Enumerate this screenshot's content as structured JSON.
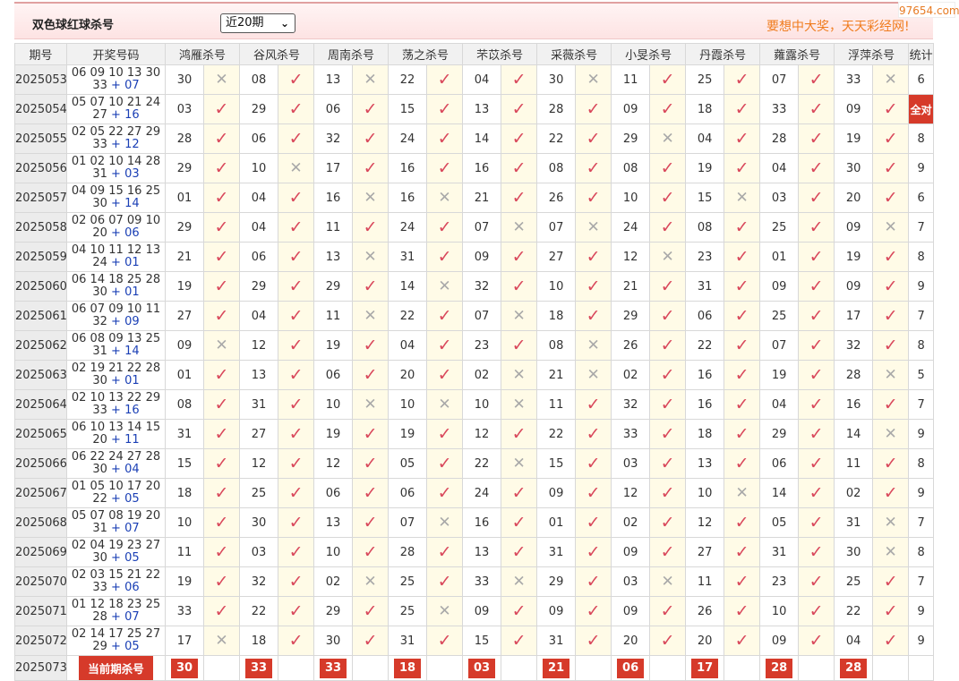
{
  "header": {
    "title": "双色球红球杀号",
    "period_select": "近20期",
    "slogan": "要想中大奖，天天彩经网!",
    "watermark": "97654.com"
  },
  "columns": {
    "issue": "期号",
    "draw": "开奖号码",
    "experts": [
      "鸿雁杀号",
      "谷风杀号",
      "周南杀号",
      "荡之杀号",
      "芣苡杀号",
      "采薇杀号",
      "小旻杀号",
      "丹霞杀号",
      "蕹露杀号",
      "浮萍杀号"
    ],
    "stat": "统计"
  },
  "rows": [
    {
      "issue": "2025053",
      "red": "06 09 10 13 30",
      "red2": "33",
      "blue": "07",
      "kills": [
        "30",
        "08",
        "13",
        "22",
        "04",
        "30",
        "11",
        "25",
        "07",
        "33"
      ],
      "hits": [
        0,
        1,
        0,
        1,
        1,
        0,
        1,
        1,
        1,
        0
      ],
      "stat": "6"
    },
    {
      "issue": "2025054",
      "red": "05 07 10 21 24",
      "red2": "27",
      "blue": "16",
      "kills": [
        "03",
        "29",
        "06",
        "15",
        "13",
        "28",
        "09",
        "18",
        "33",
        "09"
      ],
      "hits": [
        1,
        1,
        1,
        1,
        1,
        1,
        1,
        1,
        1,
        1
      ],
      "stat": "全对"
    },
    {
      "issue": "2025055",
      "red": "02 05 22 27 29",
      "red2": "33",
      "blue": "12",
      "kills": [
        "28",
        "06",
        "32",
        "24",
        "14",
        "22",
        "29",
        "04",
        "28",
        "19"
      ],
      "hits": [
        1,
        1,
        1,
        1,
        1,
        1,
        0,
        1,
        1,
        1
      ],
      "stat": "8"
    },
    {
      "issue": "2025056",
      "red": "01 02 10 14 28",
      "red2": "31",
      "blue": "03",
      "kills": [
        "29",
        "10",
        "17",
        "16",
        "16",
        "08",
        "08",
        "19",
        "04",
        "30"
      ],
      "hits": [
        1,
        0,
        1,
        1,
        1,
        1,
        1,
        1,
        1,
        1
      ],
      "stat": "9"
    },
    {
      "issue": "2025057",
      "red": "04 09 15 16 25",
      "red2": "30",
      "blue": "14",
      "kills": [
        "01",
        "04",
        "16",
        "16",
        "21",
        "26",
        "10",
        "15",
        "03",
        "20"
      ],
      "hits": [
        1,
        1,
        0,
        0,
        1,
        1,
        1,
        0,
        1,
        1
      ],
      "stat": "6"
    },
    {
      "issue": "2025058",
      "red": "02 06 07 09 10",
      "red2": "20",
      "blue": "06",
      "kills": [
        "29",
        "04",
        "11",
        "24",
        "07",
        "07",
        "24",
        "08",
        "25",
        "09"
      ],
      "hits": [
        1,
        1,
        1,
        1,
        0,
        0,
        1,
        1,
        1,
        0
      ],
      "stat": "7"
    },
    {
      "issue": "2025059",
      "red": "04 10 11 12 13",
      "red2": "24",
      "blue": "01",
      "kills": [
        "21",
        "06",
        "13",
        "31",
        "09",
        "27",
        "12",
        "23",
        "01",
        "19"
      ],
      "hits": [
        1,
        1,
        0,
        1,
        1,
        1,
        0,
        1,
        1,
        1
      ],
      "stat": "8"
    },
    {
      "issue": "2025060",
      "red": "06 14 18 25 28",
      "red2": "30",
      "blue": "01",
      "kills": [
        "19",
        "29",
        "29",
        "14",
        "32",
        "10",
        "21",
        "31",
        "09",
        "09"
      ],
      "hits": [
        1,
        1,
        1,
        0,
        1,
        1,
        1,
        1,
        1,
        1
      ],
      "stat": "9"
    },
    {
      "issue": "2025061",
      "red": "06 07 09 10 11",
      "red2": "32",
      "blue": "09",
      "kills": [
        "27",
        "04",
        "11",
        "22",
        "07",
        "18",
        "29",
        "06",
        "25",
        "17"
      ],
      "hits": [
        1,
        1,
        0,
        1,
        0,
        1,
        1,
        1,
        1,
        1
      ],
      "stat": "7"
    },
    {
      "issue": "2025062",
      "red": "06 08 09 13 25",
      "red2": "31",
      "blue": "14",
      "kills": [
        "09",
        "12",
        "19",
        "04",
        "23",
        "08",
        "26",
        "22",
        "07",
        "32"
      ],
      "hits": [
        0,
        1,
        1,
        1,
        1,
        0,
        1,
        1,
        1,
        1
      ],
      "stat": "8"
    },
    {
      "issue": "2025063",
      "red": "02 19 21 22 28",
      "red2": "30",
      "blue": "01",
      "kills": [
        "01",
        "13",
        "06",
        "20",
        "02",
        "21",
        "02",
        "16",
        "19",
        "28"
      ],
      "hits": [
        1,
        1,
        1,
        1,
        0,
        0,
        1,
        1,
        1,
        0
      ],
      "stat": "5"
    },
    {
      "issue": "2025064",
      "red": "02 10 13 22 29",
      "red2": "33",
      "blue": "16",
      "kills": [
        "08",
        "31",
        "10",
        "10",
        "10",
        "11",
        "32",
        "16",
        "04",
        "16"
      ],
      "hits": [
        1,
        1,
        0,
        0,
        0,
        1,
        1,
        1,
        1,
        1
      ],
      "stat": "7"
    },
    {
      "issue": "2025065",
      "red": "06 10 13 14 15",
      "red2": "20",
      "blue": "11",
      "kills": [
        "31",
        "27",
        "19",
        "19",
        "12",
        "22",
        "33",
        "18",
        "29",
        "14"
      ],
      "hits": [
        1,
        1,
        1,
        1,
        1,
        1,
        1,
        1,
        1,
        0
      ],
      "stat": "9"
    },
    {
      "issue": "2025066",
      "red": "06 22 24 27 28",
      "red2": "30",
      "blue": "04",
      "kills": [
        "15",
        "12",
        "12",
        "05",
        "22",
        "15",
        "03",
        "13",
        "06",
        "11"
      ],
      "hits": [
        1,
        1,
        1,
        1,
        0,
        1,
        1,
        1,
        1,
        1
      ],
      "stat": "8"
    },
    {
      "issue": "2025067",
      "red": "01 05 10 17 20",
      "red2": "22",
      "blue": "05",
      "kills": [
        "18",
        "25",
        "06",
        "06",
        "24",
        "09",
        "12",
        "10",
        "14",
        "02"
      ],
      "hits": [
        1,
        1,
        1,
        1,
        1,
        1,
        1,
        0,
        1,
        1
      ],
      "stat": "9"
    },
    {
      "issue": "2025068",
      "red": "05 07 08 19 20",
      "red2": "31",
      "blue": "07",
      "kills": [
        "10",
        "30",
        "13",
        "07",
        "16",
        "01",
        "02",
        "12",
        "05",
        "31"
      ],
      "hits": [
        1,
        1,
        1,
        0,
        1,
        1,
        1,
        1,
        1,
        0
      ],
      "stat": "7"
    },
    {
      "issue": "2025069",
      "red": "02 04 19 23 27",
      "red2": "30",
      "blue": "05",
      "kills": [
        "11",
        "03",
        "10",
        "28",
        "13",
        "31",
        "09",
        "27",
        "31",
        "30"
      ],
      "hits": [
        1,
        1,
        1,
        1,
        1,
        1,
        1,
        1,
        1,
        0
      ],
      "stat": "8"
    },
    {
      "issue": "2025070",
      "red": "02 03 15 21 22",
      "red2": "33",
      "blue": "06",
      "kills": [
        "19",
        "32",
        "02",
        "25",
        "33",
        "29",
        "03",
        "11",
        "23",
        "25"
      ],
      "hits": [
        1,
        1,
        0,
        1,
        0,
        1,
        0,
        1,
        1,
        1
      ],
      "stat": "7"
    },
    {
      "issue": "2025071",
      "red": "01 12 18 23 25",
      "red2": "28",
      "blue": "07",
      "kills": [
        "33",
        "22",
        "29",
        "25",
        "09",
        "09",
        "09",
        "26",
        "10",
        "22"
      ],
      "hits": [
        1,
        1,
        1,
        0,
        1,
        1,
        1,
        1,
        1,
        1
      ],
      "stat": "9"
    },
    {
      "issue": "2025072",
      "red": "02 14 17 25 27",
      "red2": "29",
      "blue": "05",
      "kills": [
        "17",
        "18",
        "30",
        "31",
        "15",
        "31",
        "20",
        "20",
        "09",
        "04"
      ],
      "hits": [
        0,
        1,
        1,
        1,
        1,
        1,
        1,
        1,
        1,
        1
      ],
      "stat": "9"
    }
  ],
  "current": {
    "issue": "2025073",
    "label": "当前期杀号",
    "kills": [
      "30",
      "33",
      "33",
      "18",
      "03",
      "21",
      "06",
      "17",
      "28",
      "28"
    ]
  },
  "symbols": {
    "hit": "✓",
    "miss": "✕"
  }
}
